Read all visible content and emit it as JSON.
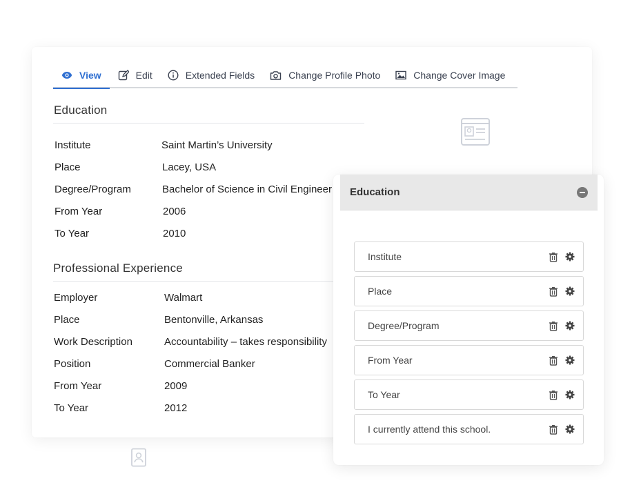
{
  "tabs": [
    {
      "label": "View",
      "icon": "eye-icon",
      "active": true
    },
    {
      "label": "Edit",
      "icon": "edit-icon"
    },
    {
      "label": "Extended Fields",
      "icon": "info-icon"
    },
    {
      "label": "Change Profile Photo",
      "icon": "camera-icon"
    },
    {
      "label": "Change Cover Image",
      "icon": "image-icon"
    }
  ],
  "education": {
    "title": "Education",
    "rows": [
      {
        "label": "Institute",
        "value": "Saint Martin’s University"
      },
      {
        "label": "Place",
        "value": "Lacey, USA"
      },
      {
        "label": "Degree/Program",
        "value": "Bachelor of Science in Civil Engineer"
      },
      {
        "label": "From Year",
        "value": "2006"
      },
      {
        "label": "To Year",
        "value": "2010"
      }
    ]
  },
  "experience": {
    "title": "Professional Experience",
    "rows": [
      {
        "label": "Employer",
        "value": "Walmart"
      },
      {
        "label": "Place",
        "value": "Bentonville, Arkansas"
      },
      {
        "label": "Work Description",
        "value": "Accountability – takes responsibility"
      },
      {
        "label": "Position",
        "value": "Commercial Banker"
      },
      {
        "label": "From Year",
        "value": "2009"
      },
      {
        "label": "To Year",
        "value": "2012"
      }
    ]
  },
  "panel": {
    "title": "Education",
    "fields": [
      {
        "label": "Institute"
      },
      {
        "label": "Place"
      },
      {
        "label": "Degree/Program"
      },
      {
        "label": "From Year"
      },
      {
        "label": "To Year"
      },
      {
        "label": "I currently attend this school."
      }
    ]
  },
  "colors": {
    "accent": "#2f6fd1",
    "panel_header": "#e8e8e8"
  }
}
